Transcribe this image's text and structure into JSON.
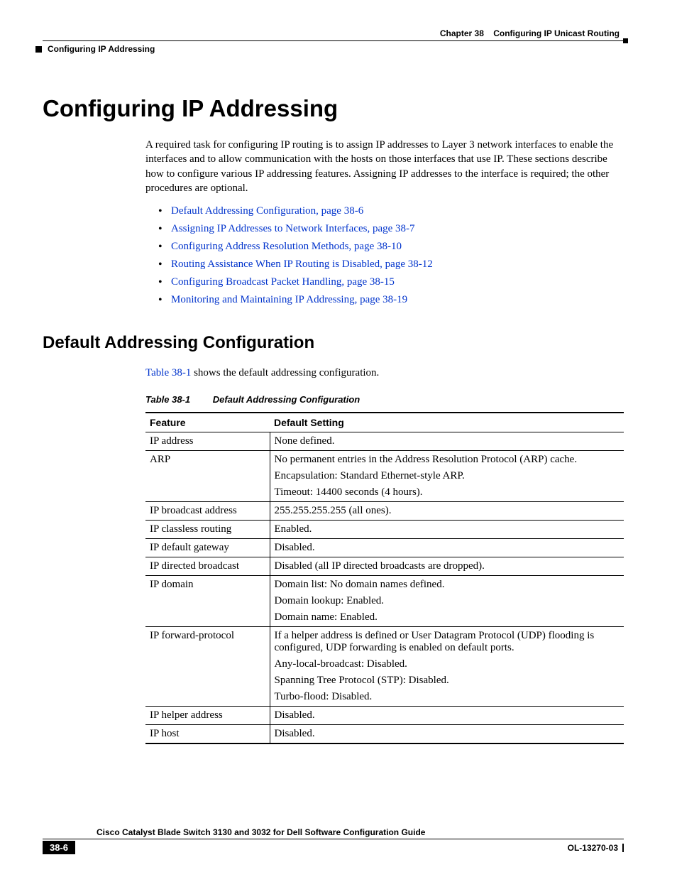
{
  "header": {
    "chapter_label": "Chapter 38",
    "chapter_title": "Configuring IP Unicast Routing",
    "running_head": "Configuring IP Addressing"
  },
  "headings": {
    "h1": "Configuring IP Addressing",
    "h2": "Default Addressing Configuration"
  },
  "intro_para": "A required task for configuring IP routing is to assign IP addresses to Layer 3 network interfaces to enable the interfaces and to allow communication with the hosts on those interfaces that use IP. These sections describe how to configure various IP addressing features. Assigning IP addresses to the interface is required; the other procedures are optional.",
  "bullets": [
    "Default Addressing Configuration, page 38-6",
    "Assigning IP Addresses to Network Interfaces, page 38-7",
    "Configuring Address Resolution Methods, page 38-10",
    "Routing Assistance When IP Routing is Disabled, page 38-12",
    "Configuring Broadcast Packet Handling, page 38-15",
    "Monitoring and Maintaining IP Addressing, page 38-19"
  ],
  "subsection_intro": {
    "link_text": "Table 38-1",
    "rest": " shows the default addressing configuration."
  },
  "table": {
    "caption_label": "Table 38-1",
    "caption_title": "Default Addressing Configuration",
    "headers": [
      "Feature",
      "Default Setting"
    ],
    "rows": [
      {
        "feature": "IP address",
        "setting": [
          "None defined."
        ]
      },
      {
        "feature": "ARP",
        "setting": [
          "No permanent entries in the Address Resolution Protocol (ARP) cache.",
          "Encapsulation: Standard Ethernet-style ARP.",
          "Timeout: 14400 seconds (4 hours)."
        ]
      },
      {
        "feature": "IP broadcast address",
        "setting": [
          "255.255.255.255 (all ones)."
        ]
      },
      {
        "feature": "IP classless routing",
        "setting": [
          "Enabled."
        ]
      },
      {
        "feature": "IP default gateway",
        "setting": [
          "Disabled."
        ]
      },
      {
        "feature": "IP directed broadcast",
        "setting": [
          "Disabled (all IP directed broadcasts are dropped)."
        ]
      },
      {
        "feature": "IP domain",
        "setting": [
          "Domain list: No domain names defined.",
          "Domain lookup: Enabled.",
          "Domain name: Enabled."
        ]
      },
      {
        "feature": "IP forward-protocol",
        "setting": [
          "If a helper address is defined or User Datagram Protocol (UDP) flooding is configured, UDP forwarding is enabled on default ports.",
          "Any-local-broadcast: Disabled.",
          "Spanning Tree Protocol (STP): Disabled.",
          "Turbo-flood: Disabled."
        ]
      },
      {
        "feature": "IP helper address",
        "setting": [
          "Disabled."
        ]
      },
      {
        "feature": "IP host",
        "setting": [
          "Disabled."
        ]
      }
    ]
  },
  "footer": {
    "guide_title": "Cisco Catalyst Blade Switch 3130 and 3032 for Dell Software Configuration Guide",
    "page_number": "38-6",
    "doc_id": "OL-13270-03"
  }
}
